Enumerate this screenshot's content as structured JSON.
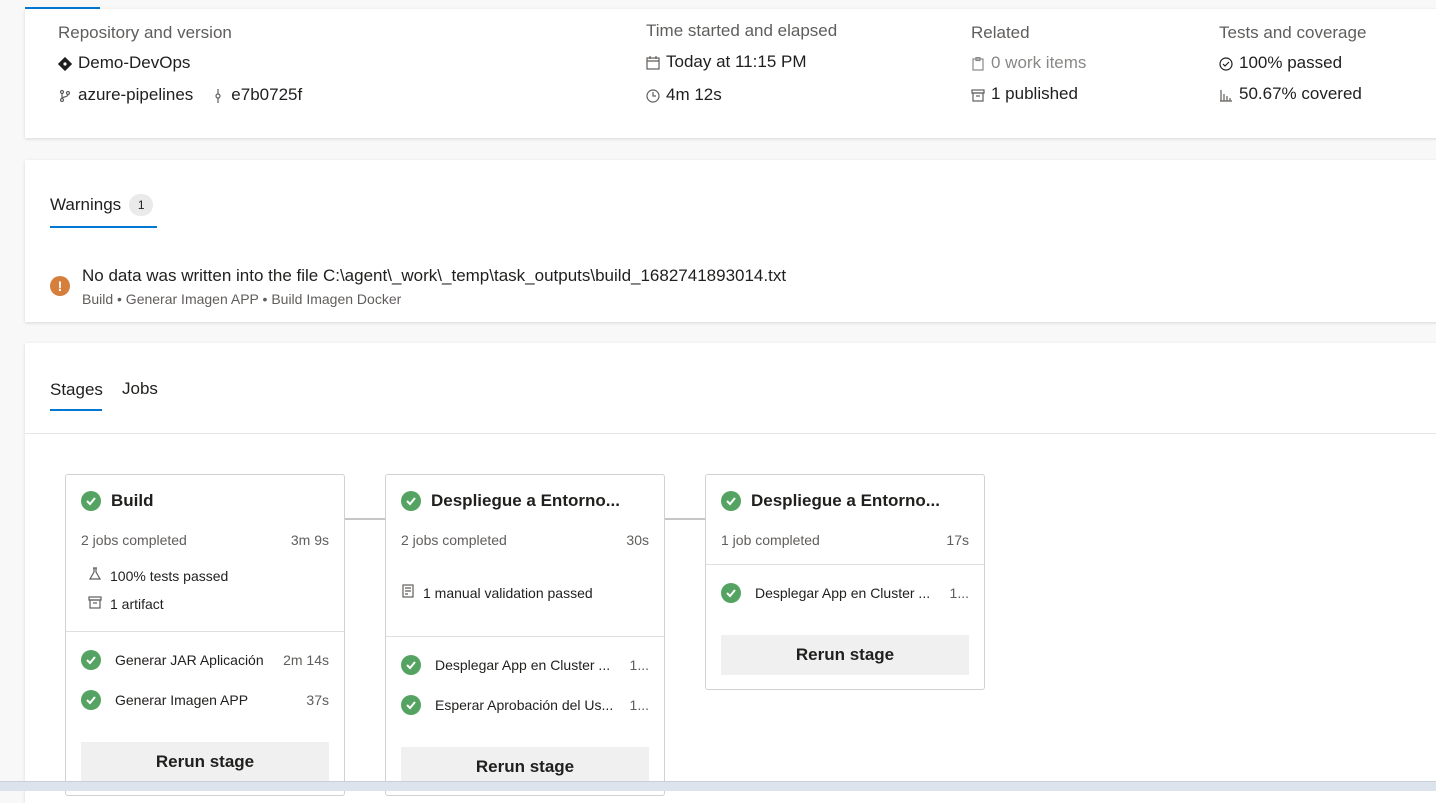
{
  "summary": {
    "repository": {
      "heading": "Repository and version",
      "repo_name": "Demo-DevOps",
      "branch": "azure-pipelines",
      "commit": "e7b0725f"
    },
    "time": {
      "heading": "Time started and elapsed",
      "started": "Today at 11:15 PM",
      "elapsed": "4m 12s"
    },
    "related": {
      "heading": "Related",
      "work_items": "0 work items",
      "published": "1 published"
    },
    "tests": {
      "heading": "Tests and coverage",
      "passed": "100% passed",
      "coverage": "50.67% covered"
    }
  },
  "warnings": {
    "tab_label": "Warnings",
    "count": "1",
    "items": [
      {
        "message": "No data was written into the file C:\\agent\\_work\\_temp\\task_outputs\\build_1682741893014.txt",
        "path": "Build • Generar Imagen APP • Build Imagen Docker"
      }
    ]
  },
  "stages_panel": {
    "tabs": [
      "Stages",
      "Jobs"
    ],
    "active_tab": "Stages",
    "stages": [
      {
        "title": "Build",
        "jobs_completed": "2 jobs completed",
        "duration": "3m 9s",
        "info": [
          "100% tests passed",
          "1 artifact"
        ],
        "jobs": [
          {
            "name": "Generar JAR Aplicación",
            "duration": "2m 14s"
          },
          {
            "name": "Generar Imagen APP",
            "duration": "37s"
          }
        ],
        "rerun_label": "Rerun stage"
      },
      {
        "title": "Despliegue a Entorno...",
        "jobs_completed": "2 jobs completed",
        "duration": "30s",
        "info": [
          "1 manual validation passed"
        ],
        "jobs": [
          {
            "name": "Desplegar App en Cluster ...",
            "duration": "1..."
          },
          {
            "name": "Esperar Aprobación del Us...",
            "duration": "1..."
          }
        ],
        "rerun_label": "Rerun stage"
      },
      {
        "title": "Despliegue a Entorno...",
        "jobs_completed": "1 job completed",
        "duration": "17s",
        "info": [],
        "jobs": [
          {
            "name": "Desplegar App en Cluster ...",
            "duration": "1..."
          }
        ],
        "rerun_label": "Rerun stage"
      }
    ]
  },
  "colors": {
    "accent": "#0078d4",
    "success": "#55a362",
    "warning": "#d67f3c"
  }
}
